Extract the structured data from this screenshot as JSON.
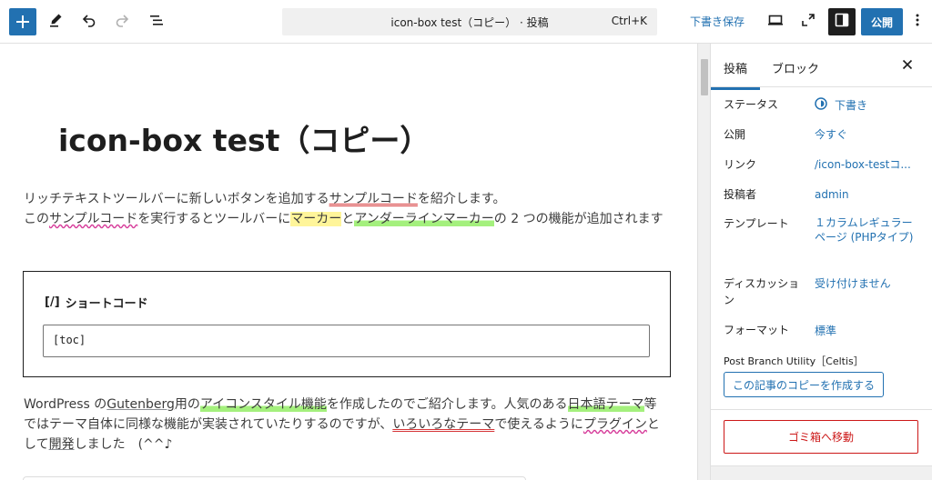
{
  "toolbar": {
    "add_icon": "plus-icon",
    "tools_icon": "pencil-icon",
    "undo_icon": "undo-icon",
    "redo_icon": "redo-icon",
    "list_view_icon": "list-view-icon",
    "command_title": "icon-box test（コピー） · 投稿",
    "command_shortcut": "Ctrl+K",
    "save_draft_label": "下書き保存",
    "preview_icon": "desktop-preview-icon",
    "external_icon": "external-view-icon",
    "settings_icon": "settings-panel-icon",
    "publish_label": "公開",
    "more_icon": "more-vertical-icon",
    "accent": "#2271b1"
  },
  "editor": {
    "title": "icon-box test（コピー）",
    "para1": {
      "l1a": "リッチテキストツールバーに新しいボタンを追加する",
      "l1b": "サンプルコード",
      "l1c": "を紹介します。",
      "l2a": "この",
      "l2b": "サンプルコード",
      "l2c": "を実行するとツールバーに",
      "l2d": "マーカー",
      "l2e": "と",
      "l2f": "アンダーラインマーカー",
      "l2g": "の 2 つの機能が追加されます"
    },
    "shortcode_block": {
      "label_icon": "[/]",
      "label": "ショートコード",
      "value": "[toc]"
    },
    "para2": {
      "a": "WordPress の",
      "b": "Gutenberg",
      "c": "用の",
      "d": "アイコンスタイル機能",
      "e": "を作成したのでご紹介します。人気のある",
      "f": "日本語テーマ",
      "g": "等ではテーマ自体に同様な機能が実装されていたりするのですが、",
      "h": "いろいろなテーマ",
      "i": "で使えるように",
      "j": "プラグイン",
      "k": "として",
      "l": "開発",
      "m": "しました　(^^♪"
    }
  },
  "sidebar": {
    "tab_post": "投稿",
    "tab_block": "ブロック",
    "close_icon": "close-icon",
    "rows": [
      {
        "label": "ステータス",
        "value": "下書き"
      },
      {
        "label": "公開",
        "value": "今すぐ"
      },
      {
        "label": "リンク",
        "value": "/icon-box-testコ..."
      },
      {
        "label": "投稿者",
        "value": "admin"
      },
      {
        "label": "テンプレート",
        "value": "１カラムレギュラーページ (PHPタイプ)"
      },
      {
        "label": "ディスカッション",
        "value": "受け付けません"
      },
      {
        "label": "フォーマット",
        "value": "標準"
      }
    ],
    "plugin_label": "Post Branch Utility［Celtis］",
    "copy_button": "この記事のコピーを作成する",
    "trash_button": "ゴミ箱へ移動",
    "danger_color": "#cc1818"
  }
}
